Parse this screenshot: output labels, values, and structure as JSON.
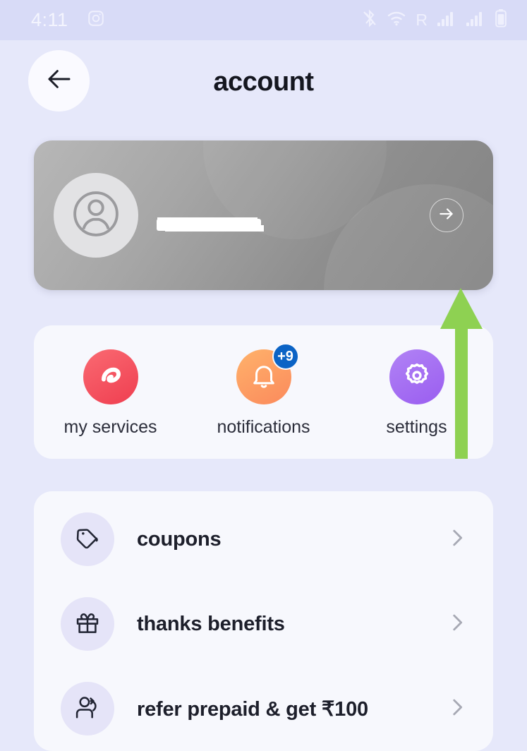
{
  "status_bar": {
    "time": "4:11",
    "left_icons": [
      {
        "name": "instagram-icon"
      }
    ],
    "right_icons": [
      {
        "name": "bluetooth-off-icon"
      },
      {
        "name": "wifi-icon"
      },
      {
        "name": "roaming-indicator",
        "label": "R"
      },
      {
        "name": "signal-bars-sim1-icon"
      },
      {
        "name": "signal-bars-sim2-icon"
      },
      {
        "name": "battery-icon"
      }
    ]
  },
  "header": {
    "title": "account",
    "back_icon": "arrow-left-icon"
  },
  "profile_card": {
    "avatar_icon": "user-avatar-icon",
    "name": "",
    "phone": "",
    "name_redacted": true,
    "phone_redacted": true,
    "arrow_icon": "arrow-right-icon"
  },
  "quick_actions": [
    {
      "id": "my-services",
      "label": "my services",
      "icon": "airtel-logo-icon",
      "badge": null,
      "color": "#ef3e50"
    },
    {
      "id": "notifications",
      "label": "notifications",
      "icon": "bell-icon",
      "badge": "+9",
      "color": "#fb8a5c",
      "badge_color": "#0b63c5"
    },
    {
      "id": "settings",
      "label": "settings",
      "icon": "gear-icon",
      "badge": null,
      "color": "#9a5df0"
    }
  ],
  "menu_items": [
    {
      "id": "coupons",
      "label": "coupons",
      "icon": "tag-icon",
      "chevron": "chevron-right-icon"
    },
    {
      "id": "thanks-benefits",
      "label": "thanks benefits",
      "icon": "gift-icon",
      "chevron": "chevron-right-icon"
    },
    {
      "id": "refer-prepaid",
      "label": "refer prepaid & get ₹100",
      "icon": "refer-person-icon",
      "chevron": "chevron-right-icon"
    }
  ],
  "annotation": {
    "type": "arrow",
    "color": "#8ed152",
    "points_to": "profile-card-arrow-button"
  },
  "theme": {
    "page_background": "#e6e8fa",
    "status_bar_background": "#d8dbf7",
    "card_background": "#f7f8fd",
    "text_primary": "#1d1f2b",
    "icon_circle_background": "#e5e4f8"
  }
}
